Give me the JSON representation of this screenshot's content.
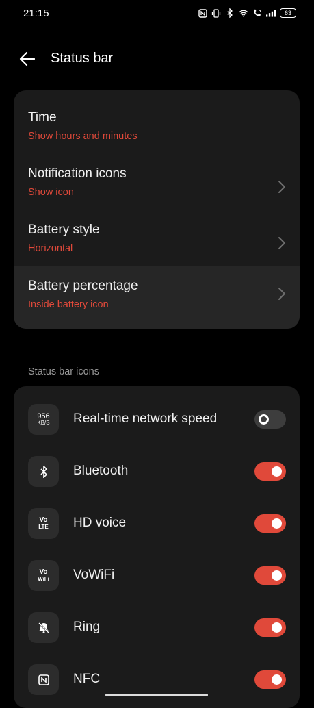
{
  "status_bar": {
    "time": "21:15",
    "icons": [
      "nfc-icon",
      "vibrate-icon",
      "bluetooth-icon",
      "wifi-icon",
      "call-icon",
      "signal-icon"
    ],
    "battery": "63"
  },
  "header": {
    "title": "Status bar"
  },
  "settings": {
    "items": [
      {
        "title": "Time",
        "subtitle": "Show hours and minutes"
      },
      {
        "title": "Notification icons",
        "subtitle": "Show icon"
      },
      {
        "title": "Battery style",
        "subtitle": "Horizontal"
      },
      {
        "title": "Battery percentage",
        "subtitle": "Inside battery icon"
      }
    ]
  },
  "icons_section": {
    "header": "Status bar icons",
    "items": [
      {
        "label": "Real-time network speed",
        "icon": "network-speed-icon",
        "icon_text_1": "956",
        "icon_text_2": "KB/S",
        "enabled": false
      },
      {
        "label": "Bluetooth",
        "icon": "bluetooth-icon",
        "enabled": true
      },
      {
        "label": "HD voice",
        "icon": "hd-voice-icon",
        "icon_text_1": "Vo",
        "icon_text_2": "LTE",
        "enabled": true
      },
      {
        "label": "VoWiFi",
        "icon": "vowifi-icon",
        "icon_text_1": "Vo",
        "icon_text_2": "WiFi",
        "enabled": true
      },
      {
        "label": "Ring",
        "icon": "ring-muted-icon",
        "enabled": true
      },
      {
        "label": "NFC",
        "icon": "nfc-icon",
        "enabled": true
      }
    ]
  },
  "colors": {
    "accent": "#e0493a",
    "card": "#1b1b1b",
    "background": "#000000"
  }
}
